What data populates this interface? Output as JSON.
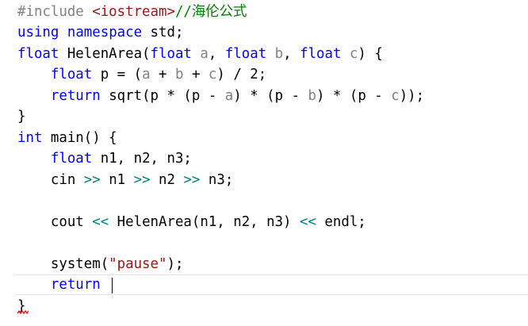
{
  "editor": {
    "language": "C++",
    "colors": {
      "background": "#ffffff",
      "keyword": "#0000ff",
      "preprocessor": "#808080",
      "include_path": "#a31515",
      "comment": "#008000",
      "parameter": "#808080",
      "stream_operator": "#008080",
      "string": "#a31515",
      "current_line_border": "#e4e4e4",
      "error_squiggle": "#ff0000"
    },
    "cursor": {
      "line": 14,
      "column": 12
    },
    "lines": [
      [
        {
          "t": "#include ",
          "c": "pp"
        },
        {
          "t": "<iostream>",
          "c": "inc"
        },
        {
          "t": "//海伦公式",
          "c": "cm"
        }
      ],
      [
        {
          "t": "using",
          "c": "kw"
        },
        {
          "t": " ",
          "c": "plain"
        },
        {
          "t": "namespace",
          "c": "kw"
        },
        {
          "t": " std;",
          "c": "plain"
        }
      ],
      [
        {
          "t": "float",
          "c": "kw"
        },
        {
          "t": " HelenArea(",
          "c": "plain"
        },
        {
          "t": "float",
          "c": "kw"
        },
        {
          "t": " ",
          "c": "plain"
        },
        {
          "t": "a",
          "c": "param"
        },
        {
          "t": ", ",
          "c": "plain"
        },
        {
          "t": "float",
          "c": "kw"
        },
        {
          "t": " ",
          "c": "plain"
        },
        {
          "t": "b",
          "c": "param"
        },
        {
          "t": ", ",
          "c": "plain"
        },
        {
          "t": "float",
          "c": "kw"
        },
        {
          "t": " ",
          "c": "plain"
        },
        {
          "t": "c",
          "c": "param"
        },
        {
          "t": ") {",
          "c": "plain"
        }
      ],
      [
        {
          "t": "    ",
          "c": "plain"
        },
        {
          "t": "float",
          "c": "kw"
        },
        {
          "t": " p = (",
          "c": "plain"
        },
        {
          "t": "a",
          "c": "param"
        },
        {
          "t": " + ",
          "c": "plain"
        },
        {
          "t": "b",
          "c": "param"
        },
        {
          "t": " + ",
          "c": "plain"
        },
        {
          "t": "c",
          "c": "param"
        },
        {
          "t": ") / 2;",
          "c": "plain"
        }
      ],
      [
        {
          "t": "    ",
          "c": "plain"
        },
        {
          "t": "return",
          "c": "kw"
        },
        {
          "t": " sqrt(p * (p - ",
          "c": "plain"
        },
        {
          "t": "a",
          "c": "param"
        },
        {
          "t": ") * (p - ",
          "c": "plain"
        },
        {
          "t": "b",
          "c": "param"
        },
        {
          "t": ") * (p - ",
          "c": "plain"
        },
        {
          "t": "c",
          "c": "param"
        },
        {
          "t": "));",
          "c": "plain"
        }
      ],
      [
        {
          "t": "}",
          "c": "plain"
        }
      ],
      [
        {
          "t": "int",
          "c": "kw"
        },
        {
          "t": " main() {",
          "c": "plain"
        }
      ],
      [
        {
          "t": "    ",
          "c": "plain"
        },
        {
          "t": "float",
          "c": "kw"
        },
        {
          "t": " n1, n2, n3;",
          "c": "plain"
        }
      ],
      [
        {
          "t": "    cin ",
          "c": "plain"
        },
        {
          "t": ">>",
          "c": "op"
        },
        {
          "t": " n1 ",
          "c": "plain"
        },
        {
          "t": ">>",
          "c": "op"
        },
        {
          "t": " n2 ",
          "c": "plain"
        },
        {
          "t": ">>",
          "c": "op"
        },
        {
          "t": " n3;",
          "c": "plain"
        }
      ],
      [],
      [
        {
          "t": "    cout ",
          "c": "plain"
        },
        {
          "t": "<<",
          "c": "op"
        },
        {
          "t": " HelenArea(n1, n2, n3) ",
          "c": "plain"
        },
        {
          "t": "<<",
          "c": "op"
        },
        {
          "t": " endl;",
          "c": "plain"
        }
      ],
      [],
      [
        {
          "t": "    system(",
          "c": "plain"
        },
        {
          "t": "\"pause\"",
          "c": "str"
        },
        {
          "t": ");",
          "c": "plain"
        }
      ],
      [
        {
          "t": "    ",
          "c": "plain"
        },
        {
          "t": "return",
          "c": "kw"
        },
        {
          "t": " ",
          "c": "plain"
        }
      ],
      [
        {
          "t": "}",
          "c": "plain"
        }
      ]
    ]
  }
}
